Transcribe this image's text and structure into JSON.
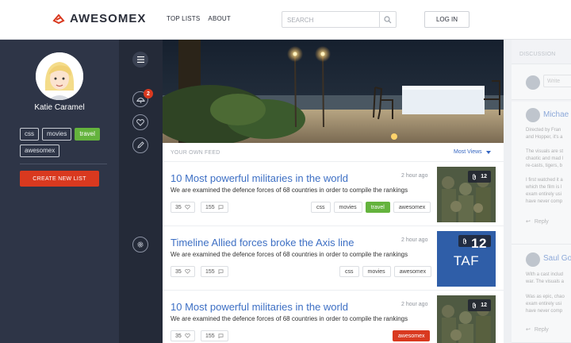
{
  "header": {
    "logo_text": "AWESOMEX",
    "nav": [
      "TOP LISTS",
      "ABOUT"
    ],
    "search_placeholder": "SEARCH",
    "login_label": "LOG IN"
  },
  "profile": {
    "name": "Katie Caramel",
    "tags": [
      {
        "label": "css",
        "active": false
      },
      {
        "label": "movies",
        "active": false
      },
      {
        "label": "travel",
        "active": true
      },
      {
        "label": "awesomex",
        "active": false
      }
    ],
    "create_button": "CREATE NEW LIST"
  },
  "rail": {
    "notification_count": "2",
    "icons": [
      "menu-icon",
      "notifications-icon",
      "heart-icon",
      "pencil-icon",
      "settings-icon"
    ]
  },
  "feed": {
    "title": "YOUR OWN FEED",
    "sort_label": "Most Views",
    "items": [
      {
        "title": "10 Most powerful militaries in the world",
        "time": "2 hour ago",
        "desc": "We are examined the defence forces of 68 countries in order to compile the rankings",
        "likes": "35",
        "comments": "155",
        "tags": [
          "css",
          "movies",
          "travel",
          "awesomex"
        ],
        "attachments": "12",
        "thumb": "soldiers"
      },
      {
        "title": "Timeline Allied forces broke the Axis line",
        "time": "2 hour ago",
        "desc": "We are examined the defence forces of 68 countries in order to compile the rankings",
        "likes": "35",
        "comments": "155",
        "tags": [
          "css",
          "movies",
          "awesomex"
        ],
        "attachments": "12",
        "thumb_text": "TAF"
      },
      {
        "title": "10 Most powerful militaries in the world",
        "time": "2 hour ago",
        "desc": "We are examined the defence forces of 68 countries in order to compile the rankings",
        "likes": "35",
        "comments": "155",
        "tags": [
          "awesomex"
        ],
        "attachments": "12",
        "thumb": "soldiers"
      }
    ]
  },
  "discussion": {
    "title": "DISCUSSION",
    "input_placeholder": "Write",
    "comments": [
      {
        "author": "Michae",
        "lines": [
          "Directed by Fran",
          "and Hopper, it's a",
          "",
          "The visuals are st",
          "chaotic and mad l",
          "re-casts, tigers, b",
          "",
          "I first watched it a",
          "which the film is l",
          "exam entirely usi",
          "have never comp"
        ],
        "reply": "Reply"
      },
      {
        "author": "Saul Go",
        "lines": [
          "With a cast includ",
          "war. The visuals a",
          "",
          "Was as epic, chao",
          "exam entirely usi",
          "have never comp"
        ],
        "reply": "Reply"
      }
    ]
  },
  "colors": {
    "accent_blue": "#3d6fc4",
    "accent_red": "#d9391f",
    "tag_green": "#64b33d",
    "sidebar_dark": "#2e3547"
  }
}
